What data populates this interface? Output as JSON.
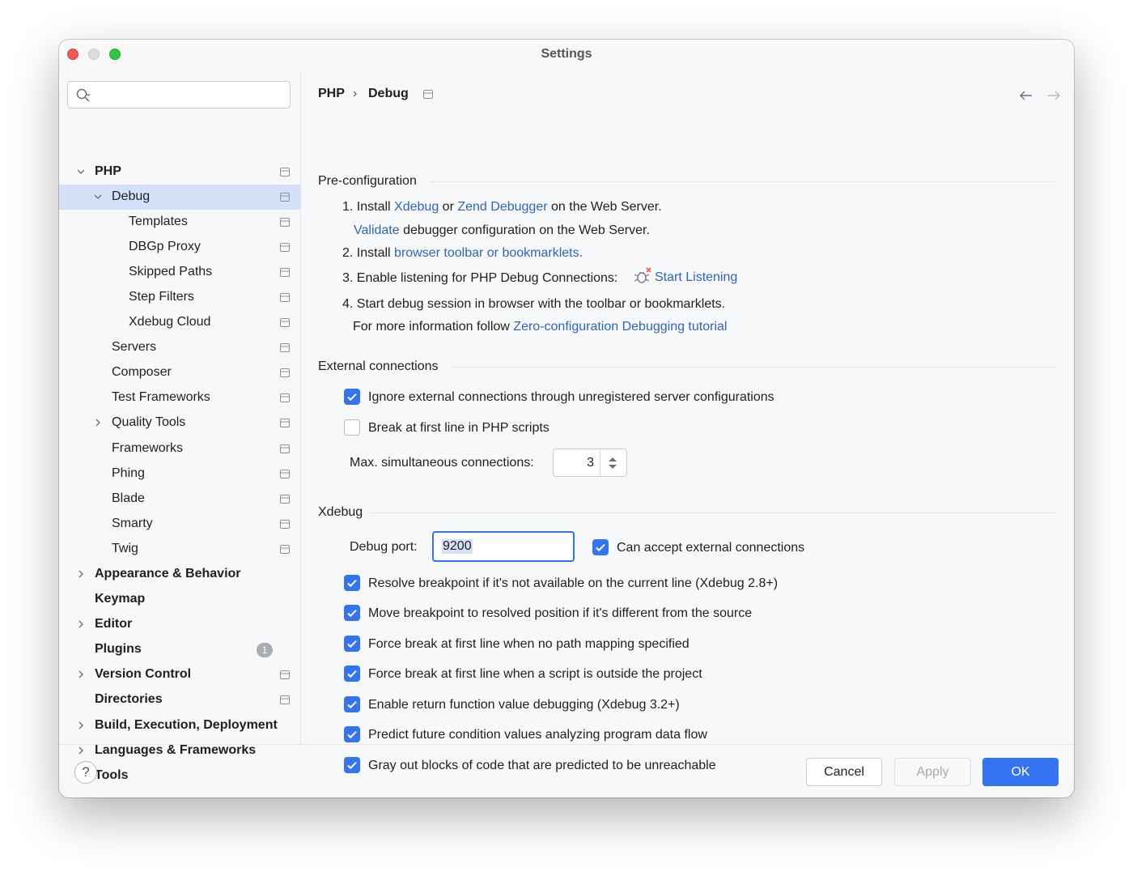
{
  "window": {
    "title": "Settings"
  },
  "search": {
    "placeholder": ""
  },
  "sidebar": {
    "items": [
      {
        "label": "PHP",
        "bold": true
      },
      {
        "label": "Debug"
      },
      {
        "label": "Templates"
      },
      {
        "label": "DBGp Proxy"
      },
      {
        "label": "Skipped Paths"
      },
      {
        "label": "Step Filters"
      },
      {
        "label": "Xdebug Cloud"
      },
      {
        "label": "Servers"
      },
      {
        "label": "Composer"
      },
      {
        "label": "Test Frameworks"
      },
      {
        "label": "Quality Tools"
      },
      {
        "label": "Frameworks"
      },
      {
        "label": "Phing"
      },
      {
        "label": "Blade"
      },
      {
        "label": "Smarty"
      },
      {
        "label": "Twig"
      },
      {
        "label": "Appearance & Behavior",
        "bold": true
      },
      {
        "label": "Keymap",
        "bold": true
      },
      {
        "label": "Editor",
        "bold": true
      },
      {
        "label": "Plugins",
        "bold": true,
        "badge": "1"
      },
      {
        "label": "Version Control",
        "bold": true
      },
      {
        "label": "Directories",
        "bold": true
      },
      {
        "label": "Build, Execution, Deployment",
        "bold": true
      },
      {
        "label": "Languages & Frameworks",
        "bold": true
      },
      {
        "label": "Tools",
        "bold": true
      }
    ]
  },
  "breadcrumb": {
    "parent": "PHP",
    "separator": "›",
    "current": "Debug"
  },
  "preconfig": {
    "title": "Pre-configuration",
    "step1_prefix": "1. Install",
    "step1_link1": "Xdebug",
    "step1_or": "or",
    "step1_link2": "Zend Debugger",
    "step1_suffix": "on the Web Server.",
    "validate_link": "Validate",
    "validate_suffix": "debugger configuration on the Web Server.",
    "step2_prefix": "2. Install",
    "step2_link": "browser toolbar or bookmarklets.",
    "step3_text": "3. Enable listening for PHP Debug Connections:",
    "step3_link": "Start Listening",
    "step4_text": "4. Start debug session in browser with the toolbar or bookmarklets.",
    "info_prefix": "For more information follow",
    "info_link": "Zero-configuration Debugging tutorial"
  },
  "external": {
    "title": "External connections",
    "ignore_label": "Ignore external connections through unregistered server configurations",
    "ignore_checked": true,
    "break_label": "Break at first line in PHP scripts",
    "break_checked": false,
    "max_label": "Max. simultaneous connections:",
    "max_value": "3"
  },
  "xdebug": {
    "title": "Xdebug",
    "port_label": "Debug port:",
    "port_value": "9200",
    "accept_label": "Can accept external connections",
    "options": [
      "Resolve breakpoint if it's not available on the current line (Xdebug 2.8+)",
      "Move breakpoint to resolved position if it's different from the source",
      "Force break at first line when no path mapping specified",
      "Force break at first line when a script is outside the project",
      "Enable return function value debugging (Xdebug 3.2+)",
      "Predict future condition values analyzing program data flow",
      "Gray out blocks of code that are predicted to be unreachable"
    ]
  },
  "footer": {
    "help": "?",
    "cancel": "Cancel",
    "apply": "Apply",
    "ok": "OK"
  },
  "colors": {
    "accent": "#3574f0",
    "link": "#2f63c9",
    "selection": "#d5e1f8"
  }
}
